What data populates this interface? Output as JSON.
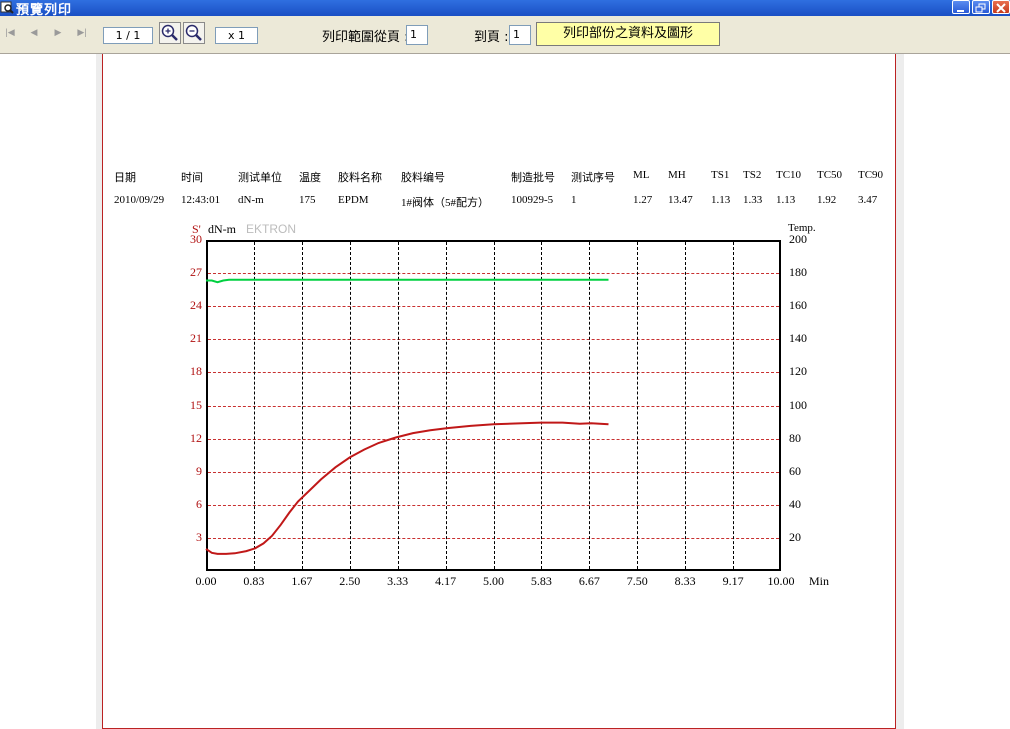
{
  "window": {
    "title": "預覽列印"
  },
  "toolbar": {
    "page_indicator": "1 / 1",
    "zoom_factor": "x 1",
    "range_from_label": "列印範圍從頁 :",
    "range_from_value": "1",
    "range_to_label": "到頁 :",
    "range_to_value": "1",
    "print_button": "列印部份之資料及圖形"
  },
  "report": {
    "headers": [
      "日期",
      "时间",
      "测试单位",
      "温度",
      "胶料名称",
      "胶料编号",
      "制造批号",
      "测试序号",
      "ML",
      "MH",
      "TS1",
      "TS2",
      "TC10",
      "TC50",
      "TC90"
    ],
    "values": [
      "2010/09/29",
      "12:43:01",
      "dN-m",
      "175",
      "EPDM",
      "1#阀体（5#配方）",
      "100929-5",
      "1",
      "1.27",
      "13.47",
      "1.13",
      "1.33",
      "1.13",
      "1.92",
      "3.47"
    ]
  },
  "chart_data": {
    "type": "line",
    "left_axis_label": "S'",
    "left_axis_unit": "dN-m",
    "brand": "EKTRON",
    "right_axis_label": "Temp.",
    "x_unit": "Min",
    "xlim": [
      0,
      10
    ],
    "ylim_left": [
      0,
      30
    ],
    "ylim_right": [
      0,
      200
    ],
    "x_ticks": [
      "0.00",
      "0.83",
      "1.67",
      "2.50",
      "3.33",
      "4.17",
      "5.00",
      "5.83",
      "6.67",
      "7.50",
      "8.33",
      "9.17",
      "10.00"
    ],
    "y_ticks_left": [
      "30",
      "27",
      "24",
      "21",
      "18",
      "15",
      "12",
      "9",
      "6",
      "3"
    ],
    "y_ticks_right": [
      "200",
      "180",
      "160",
      "140",
      "120",
      "100",
      "80",
      "60",
      "40",
      "20"
    ],
    "grid": true,
    "series": [
      {
        "axis": "left",
        "color": "#c01818",
        "x": [
          0.0,
          0.1,
          0.2,
          0.35,
          0.5,
          0.7,
          0.85,
          1.0,
          1.15,
          1.3,
          1.45,
          1.6,
          1.8,
          2.0,
          2.25,
          2.5,
          2.75,
          3.0,
          3.3,
          3.6,
          3.9,
          4.2,
          4.6,
          5.0,
          5.5,
          5.83,
          6.2,
          6.5,
          6.7,
          7.0
        ],
        "y": [
          2.0,
          1.65,
          1.55,
          1.55,
          1.6,
          1.8,
          2.05,
          2.5,
          3.2,
          4.2,
          5.3,
          6.3,
          7.3,
          8.3,
          9.4,
          10.3,
          11.0,
          11.6,
          12.1,
          12.5,
          12.75,
          12.95,
          13.15,
          13.3,
          13.4,
          13.45,
          13.45,
          13.35,
          13.4,
          13.3
        ]
      },
      {
        "axis": "right",
        "color": "#00d040",
        "x": [
          0.0,
          0.1,
          0.2,
          0.3,
          0.4,
          0.6,
          1.0,
          2.0,
          3.0,
          4.0,
          5.0,
          6.0,
          7.0
        ],
        "y": [
          175.5,
          175.5,
          174.5,
          175.5,
          176,
          176,
          176,
          176,
          176,
          176,
          176,
          176,
          176
        ]
      }
    ]
  }
}
